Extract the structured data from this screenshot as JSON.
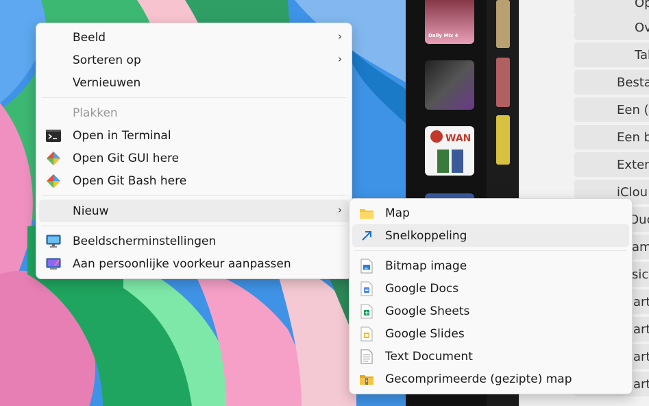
{
  "context_menu": {
    "items": [
      {
        "label": "Beeld",
        "submenu": true
      },
      {
        "label": "Sorteren op",
        "submenu": true
      },
      {
        "label": "Vernieuwen"
      },
      {
        "label": "Plakken",
        "disabled": true
      },
      {
        "label": "Open in Terminal",
        "icon": "terminal-icon"
      },
      {
        "label": "Open Git GUI here",
        "icon": "git-icon"
      },
      {
        "label": "Open Git Bash here",
        "icon": "git-icon"
      },
      {
        "label": "Nieuw",
        "submenu": true
      },
      {
        "label": "Beeldscherminstellingen",
        "icon": "display-icon"
      },
      {
        "label": "Aan persoonlijke voorkeur aanpassen",
        "icon": "personalize-icon"
      }
    ]
  },
  "new_submenu": {
    "items": [
      {
        "label": "Map",
        "icon": "folder-icon"
      },
      {
        "label": "Snelkoppeling",
        "icon": "shortcut-arrow-icon"
      },
      {
        "label": "Bitmap image",
        "icon": "bitmap-icon"
      },
      {
        "label": "Google Docs",
        "icon": "google-docs-icon"
      },
      {
        "label": "Google Sheets",
        "icon": "google-sheets-icon"
      },
      {
        "label": "Google Slides",
        "icon": "google-slides-icon"
      },
      {
        "label": "Text Document",
        "icon": "text-document-icon"
      },
      {
        "label": "Gecomprimeerde (gezipte) map",
        "icon": "zip-folder-icon"
      }
    ]
  },
  "background_window": {
    "thumb_caption": "Daily Mix 4",
    "wan_label": "WAN",
    "settings_rows": [
      "Op",
      "Ov",
      "Tak",
      "Besta",
      "Een (",
      "Een b",
      "Exten",
      "iClou",
      "Ouc",
      "am",
      "sic",
      "art",
      "art",
      "art",
      "art"
    ]
  },
  "colors": {
    "accent": "#0067c0",
    "menu_bg": "#f9f9f9",
    "hover": "#ececec"
  }
}
